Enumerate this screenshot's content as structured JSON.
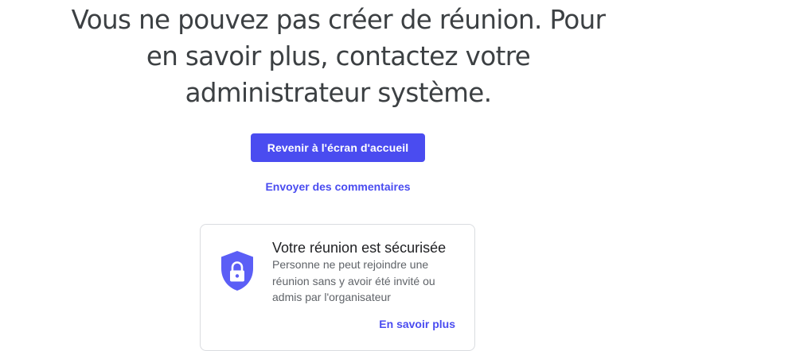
{
  "message": {
    "line1": "Vous ne pouvez pas créer de réunion. Pour",
    "line2": "en savoir plus, contactez votre",
    "line3": "administrateur système."
  },
  "actions": {
    "home_button_label": "Revenir à l'écran d'accueil",
    "feedback_link_label": "Envoyer des commentaires"
  },
  "security_card": {
    "icon": "shield-lock-icon",
    "title": "Votre réunion est sécurisée",
    "body_line1": "Personne ne peut rejoindre une",
    "body_line2": "réunion sans y avoir été invité ou",
    "body_line3": "admis par l'organisateur",
    "link_label": "En savoir plus"
  },
  "colors": {
    "accent": "#4a4cf0",
    "shield_fill": "#5b5ef6",
    "heading_text": "#3c4043",
    "body_text": "#5f6368",
    "card_border": "#dadce0"
  }
}
